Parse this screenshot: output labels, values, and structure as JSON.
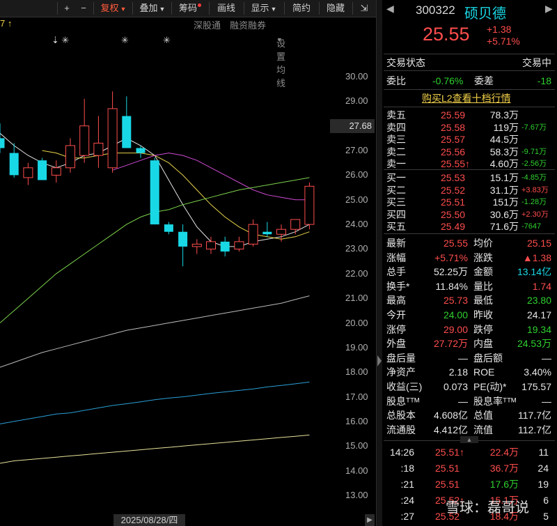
{
  "toolbar": {
    "items": [
      {
        "label": "+",
        "active": false
      },
      {
        "label": "−",
        "active": false
      },
      {
        "label": "复权",
        "active": true
      },
      {
        "label": "叠加",
        "active": false
      },
      {
        "label": "筹码",
        "active": false
      },
      {
        "label": "画线",
        "active": false
      },
      {
        "label": "显示",
        "active": false
      },
      {
        "label": "简约",
        "active": false
      },
      {
        "label": "隐藏",
        "active": false
      }
    ],
    "collapse_glyph": "⇲"
  },
  "subbar": {
    "left_fragment": "7 ↑",
    "links": [
      "深股通",
      "融资融券",
      "设置均线"
    ],
    "markers": [
      "⇣ ✳",
      "✳",
      "✳"
    ]
  },
  "colors": {
    "up": "#ff4d4d",
    "down": "#19d8e6",
    "ma5": "#e6e6e6",
    "ma10": "#e8d44a",
    "ma20": "#d14bd6",
    "ma30": "#7bd34b",
    "ma60": "#bbbbbb",
    "ma120": "#2a9fd6",
    "ma250": "#e8e29a"
  },
  "chart_data": {
    "type": "candlestick",
    "ylim": [
      12.7,
      30.6
    ],
    "y_ticks": [
      13.0,
      14.0,
      15.0,
      16.0,
      17.0,
      18.0,
      19.0,
      20.0,
      21.0,
      22.0,
      23.0,
      24.0,
      25.0,
      26.0,
      27.0,
      28.0,
      29.0,
      30.0
    ],
    "last_price_tag": "27.68",
    "date_tag": "2025/08/28/四",
    "candles": [
      {
        "o": 27.5,
        "h": 28.1,
        "l": 26.9,
        "c": 27.1
      },
      {
        "o": 26.9,
        "h": 27.3,
        "l": 25.9,
        "c": 26.0
      },
      {
        "o": 25.9,
        "h": 26.5,
        "l": 25.6,
        "c": 26.3
      },
      {
        "o": 26.6,
        "h": 26.7,
        "l": 25.8,
        "c": 25.8
      },
      {
        "o": 26.0,
        "h": 26.6,
        "l": 25.7,
        "c": 26.3
      },
      {
        "o": 26.3,
        "h": 27.5,
        "l": 26.1,
        "c": 27.2
      },
      {
        "o": 26.8,
        "h": 29.1,
        "l": 26.5,
        "c": 28.0
      },
      {
        "o": 26.8,
        "h": 28.4,
        "l": 26.3,
        "c": 27.3
      },
      {
        "o": 26.3,
        "h": 29.4,
        "l": 26.1,
        "c": 28.7
      },
      {
        "o": 28.4,
        "h": 29.2,
        "l": 27.3,
        "c": 27.1
      },
      {
        "o": 27.1,
        "h": 27.2,
        "l": 26.7,
        "c": 26.9
      },
      {
        "o": 26.6,
        "h": 26.7,
        "l": 24.0,
        "c": 24.0
      },
      {
        "o": 24.0,
        "h": 24.1,
        "l": 23.6,
        "c": 23.7
      },
      {
        "o": 23.7,
        "h": 24.0,
        "l": 22.3,
        "c": 23.1
      },
      {
        "o": 23.1,
        "h": 23.4,
        "l": 22.8,
        "c": 23.2
      },
      {
        "o": 23.0,
        "h": 23.5,
        "l": 22.8,
        "c": 23.3
      },
      {
        "o": 23.3,
        "h": 23.5,
        "l": 22.7,
        "c": 22.9
      },
      {
        "o": 23.0,
        "h": 23.5,
        "l": 22.9,
        "c": 23.3
      },
      {
        "o": 23.2,
        "h": 24.2,
        "l": 23.1,
        "c": 24.0
      },
      {
        "o": 23.7,
        "h": 24.1,
        "l": 23.5,
        "c": 23.6
      },
      {
        "o": 23.6,
        "h": 24.0,
        "l": 23.3,
        "c": 23.8
      },
      {
        "o": 23.8,
        "h": 24.2,
        "l": 23.6,
        "c": 24.2
      },
      {
        "o": 24.0,
        "h": 25.7,
        "l": 23.8,
        "c": 25.55
      }
    ],
    "ma_lines": [
      {
        "key": "ma5",
        "values": [
          27.7,
          27.2,
          26.8,
          26.5,
          26.3,
          26.5,
          26.8,
          26.9,
          27.2,
          27.5,
          27.2,
          26.8,
          25.8,
          24.8,
          23.9,
          23.3,
          23.1,
          23.1,
          23.3,
          23.4,
          23.5,
          23.7,
          24.0
        ]
      },
      {
        "key": "ma10",
        "values": [
          null,
          null,
          null,
          27.0,
          26.9,
          26.7,
          26.7,
          26.8,
          26.9,
          26.9,
          26.9,
          26.8,
          26.5,
          26.0,
          25.4,
          24.8,
          24.3,
          23.9,
          23.6,
          23.5,
          23.4,
          23.5,
          23.7
        ]
      },
      {
        "key": "ma20",
        "values": [
          null,
          null,
          null,
          null,
          null,
          null,
          null,
          null,
          26.2,
          26.4,
          26.6,
          26.8,
          26.9,
          26.8,
          26.6,
          26.3,
          26.0,
          25.7,
          25.4,
          25.2,
          25.1,
          25.0,
          25.0
        ]
      },
      {
        "key": "ma30",
        "values": [
          20.0,
          20.5,
          21.0,
          21.5,
          22.0,
          22.4,
          22.8,
          23.2,
          23.6,
          24.0,
          24.3,
          24.5,
          24.6,
          24.8,
          24.95,
          25.1,
          25.25,
          25.4,
          25.5,
          25.6,
          25.7,
          25.8,
          25.9
        ]
      },
      {
        "key": "ma60",
        "values": [
          18.2,
          18.4,
          18.6,
          18.8,
          18.95,
          19.1,
          19.25,
          19.4,
          19.55,
          19.7,
          19.8,
          19.9,
          20.0,
          20.1,
          20.2,
          20.3,
          20.4,
          20.5,
          20.6,
          20.7,
          20.8,
          20.95,
          21.1
        ]
      },
      {
        "key": "ma120",
        "values": [
          15.9,
          16.0,
          16.1,
          16.2,
          16.3,
          16.35,
          16.45,
          16.55,
          16.65,
          16.72,
          16.8,
          16.88,
          16.95,
          17.0,
          17.07,
          17.14,
          17.2,
          17.26,
          17.32,
          17.4,
          17.46,
          17.53,
          17.6
        ]
      },
      {
        "key": "ma250",
        "values": [
          14.3,
          14.4,
          14.45,
          14.5,
          14.55,
          14.6,
          14.65,
          14.7,
          14.75,
          14.8,
          14.85,
          14.9,
          14.95,
          15.0,
          15.05,
          15.1,
          15.15,
          15.2,
          15.25,
          15.3,
          15.35,
          15.4,
          15.45
        ]
      }
    ]
  },
  "quote": {
    "code": "300322",
    "name": "硕贝德",
    "price": "25.55",
    "change": "+1.38",
    "change_pct": "+5.71%",
    "status_label": "交易状态",
    "status_value": "交易中",
    "weibi_label": "委比",
    "weibi_value": "-0.76%",
    "weicha_label": "委差",
    "weicha_value": "-18",
    "l2_link": "购买L2查看十档行情"
  },
  "order_book": {
    "asks": [
      {
        "label": "卖五",
        "price": "25.59",
        "vol": "78.3万",
        "chg": ""
      },
      {
        "label": "卖四",
        "price": "25.58",
        "vol": "119万",
        "chg": "-7.67万"
      },
      {
        "label": "卖三",
        "price": "25.57",
        "vol": "44.5万",
        "chg": ""
      },
      {
        "label": "卖二",
        "price": "25.56",
        "vol": "58.3万",
        "chg": "-9.71万"
      },
      {
        "label": "卖一",
        "price": "25.55↑",
        "vol": "4.60万",
        "chg": "-2.56万"
      }
    ],
    "bids": [
      {
        "label": "买一",
        "price": "25.53",
        "vol": "15.1万",
        "chg": "-4.85万"
      },
      {
        "label": "买二",
        "price": "25.52",
        "vol": "31.1万",
        "chg": "+3.83万"
      },
      {
        "label": "买三",
        "price": "25.51",
        "vol": "151万",
        "chg": "-1.28万"
      },
      {
        "label": "买四",
        "price": "25.50",
        "vol": "30.6万",
        "chg": "+2.30万"
      },
      {
        "label": "买五",
        "price": "25.49",
        "vol": "71.6万",
        "chg": "-7647"
      }
    ]
  },
  "stats": [
    {
      "l1": "最新",
      "v1": "25.55",
      "c1": "red",
      "l2": "均价",
      "v2": "25.15",
      "c2": "red"
    },
    {
      "l1": "涨幅",
      "v1": "+5.71%",
      "c1": "red",
      "l2": "涨跌",
      "v2": "▲1.38",
      "c2": "red"
    },
    {
      "l1": "总手",
      "v1": "52.25万",
      "c1": "white",
      "l2": "金额",
      "v2": "13.14亿",
      "c2": "cyan"
    },
    {
      "l1": "换手*",
      "v1": "11.84%",
      "c1": "white",
      "l2": "量比",
      "v2": "1.74",
      "c2": "red"
    },
    {
      "l1": "最高",
      "v1": "25.73",
      "c1": "red",
      "l2": "最低",
      "v2": "23.80",
      "c2": "green"
    },
    {
      "l1": "今开",
      "v1": "24.00",
      "c1": "green",
      "l2": "昨收",
      "v2": "24.17",
      "c2": "white"
    },
    {
      "l1": "涨停",
      "v1": "29.00",
      "c1": "red",
      "l2": "跌停",
      "v2": "19.34",
      "c2": "green"
    },
    {
      "l1": "外盘",
      "v1": "27.72万",
      "c1": "red",
      "l2": "内盘",
      "v2": "24.53万",
      "c2": "green"
    },
    {
      "l1": "盘后量",
      "v1": "—",
      "c1": "white",
      "l2": "盘后额",
      "v2": "—",
      "c2": "white"
    },
    {
      "l1": "净资产",
      "v1": "2.18",
      "c1": "white",
      "l2": "ROE",
      "v2": "3.40%",
      "c2": "white"
    },
    {
      "l1": "收益(三)",
      "v1": "0.073",
      "c1": "white",
      "l2": "PE(动)*",
      "v2": "175.57",
      "c2": "white"
    },
    {
      "l1": "股息ᵀᵀᴹ",
      "v1": "—",
      "c1": "white",
      "l2": "股息率ᵀᵀᴹ",
      "v2": "—",
      "c2": "white"
    },
    {
      "l1": "总股本",
      "v1": "4.608亿",
      "c1": "white",
      "l2": "总值",
      "v2": "117.7亿",
      "c2": "white"
    },
    {
      "l1": "流通股",
      "v1": "4.412亿",
      "c1": "white",
      "l2": "流值",
      "v2": "112.7亿",
      "c2": "white"
    }
  ],
  "ticks": [
    {
      "time": "14:26",
      "price": "25.51↑",
      "pc": "red",
      "vol": "22.4万",
      "vc": "red",
      "n": "11"
    },
    {
      "time": ":18",
      "price": "25.51",
      "pc": "red",
      "vol": "36.7万",
      "vc": "red",
      "n": "24"
    },
    {
      "time": ":21",
      "price": "25.51",
      "pc": "red",
      "vol": "17.6万",
      "vc": "green",
      "n": "19"
    },
    {
      "time": ":24",
      "price": "25.52↑",
      "pc": "red",
      "vol": "15.1万",
      "vc": "red",
      "n": "6"
    },
    {
      "time": ":27",
      "price": "25.52",
      "pc": "red",
      "vol": "18.4万",
      "vc": "red",
      "n": "5"
    }
  ],
  "watermark": "雪球：磊哥说"
}
